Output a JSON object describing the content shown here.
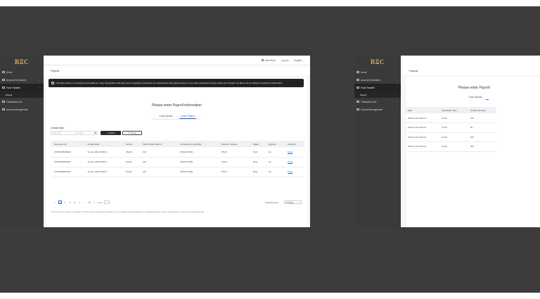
{
  "app": {
    "logo": "BΞC"
  },
  "sidebar": {
    "items": [
      {
        "label": "Home",
        "icon": "home-icon"
      },
      {
        "label": "Account Information",
        "icon": "account-icon"
      },
      {
        "label": "Fund Transfer",
        "icon": "transfer-icon"
      },
      {
        "label": "Transaction List",
        "icon": "list-icon"
      },
      {
        "label": "Account Management",
        "icon": "settings-icon"
      }
    ],
    "subitems": {
      "payroll": "Payroll"
    }
  },
  "topbar": {
    "view_more": "View More",
    "logout": "Log out",
    "language": "English"
  },
  "breadcrumb": "Payroll",
  "notice": "The History Menu is exclusively accessible for mass transactions that have been completely successful. For transactions with partial success or any other transaction history status, the Transfer List Menu can be utilized to search for information.",
  "page_title": "Please enter Payroll information",
  "tabs": [
    "Local Upload",
    "Quick Payroll"
  ],
  "filter": {
    "created_date_label": "Created Date",
    "start_placeholder": "Start date",
    "end_placeholder": "End date",
    "separator": "~",
    "search_label": "Search",
    "reset_label": "Reset"
  },
  "table": {
    "columns": [
      "Reference No.",
      "Created Date",
      "Service",
      "Total Transfer Record",
      "Transaction Amount(Rp)",
      "Payment Channel",
      "Maker",
      "Approver",
      "Operation"
    ],
    "rows": [
      [
        "137839138915918",
        "14 Jan, 2022 23:00:14",
        "Payroll",
        "100",
        "8,904,374,984",
        "RTGS",
        "Budi",
        "Ani",
        "Detail"
      ],
      [
        "137839138915918",
        "14 Jan, 2022 23:00:14",
        "Payroll",
        "100",
        "8,904,374,984",
        "Online",
        "Budi",
        "Ani",
        "Detail"
      ],
      [
        "137839138915918",
        "14 Jan, 2022 23:00:14",
        "Payroll",
        "100",
        "8,904,374,984",
        "RTGS",
        "Budi",
        "Ani",
        "Detail"
      ]
    ]
  },
  "pager": {
    "prev": "<",
    "pages": [
      "1",
      "2",
      "3",
      "4",
      "5"
    ],
    "ellipsis": "...",
    "last": "50",
    "next": ">",
    "goto": "Go to",
    "total": "Total 500 items",
    "page_size": "10/Page"
  },
  "footnote": "The time for the system to transfer via RTGS does not support transfers on non-working days (weekends or holidays), please select a working day to ensure successful transfer.",
  "window2": {
    "breadcrumb": "Payroll",
    "page_title": "Please enter Payroll",
    "tabs": [
      "Local Upload"
    ],
    "columns": [
      "Date",
      "Transaction Type",
      "Transfer Records"
    ],
    "rows": [
      [
        "2022-10-14 23:00:14",
        "Credit",
        "100"
      ],
      [
        "2022-10-14 23:00:14",
        "Credit",
        "50"
      ],
      [
        "2022-10-14 23:00:14",
        "Credit",
        "200"
      ],
      [
        "2022-10-14 23:00:14",
        "Credit",
        "300"
      ]
    ]
  },
  "colors": {
    "sidebar": "#3a3a3a",
    "accent": "#1f6fd1",
    "logo": "#d6b25e",
    "notice": "#222222"
  }
}
